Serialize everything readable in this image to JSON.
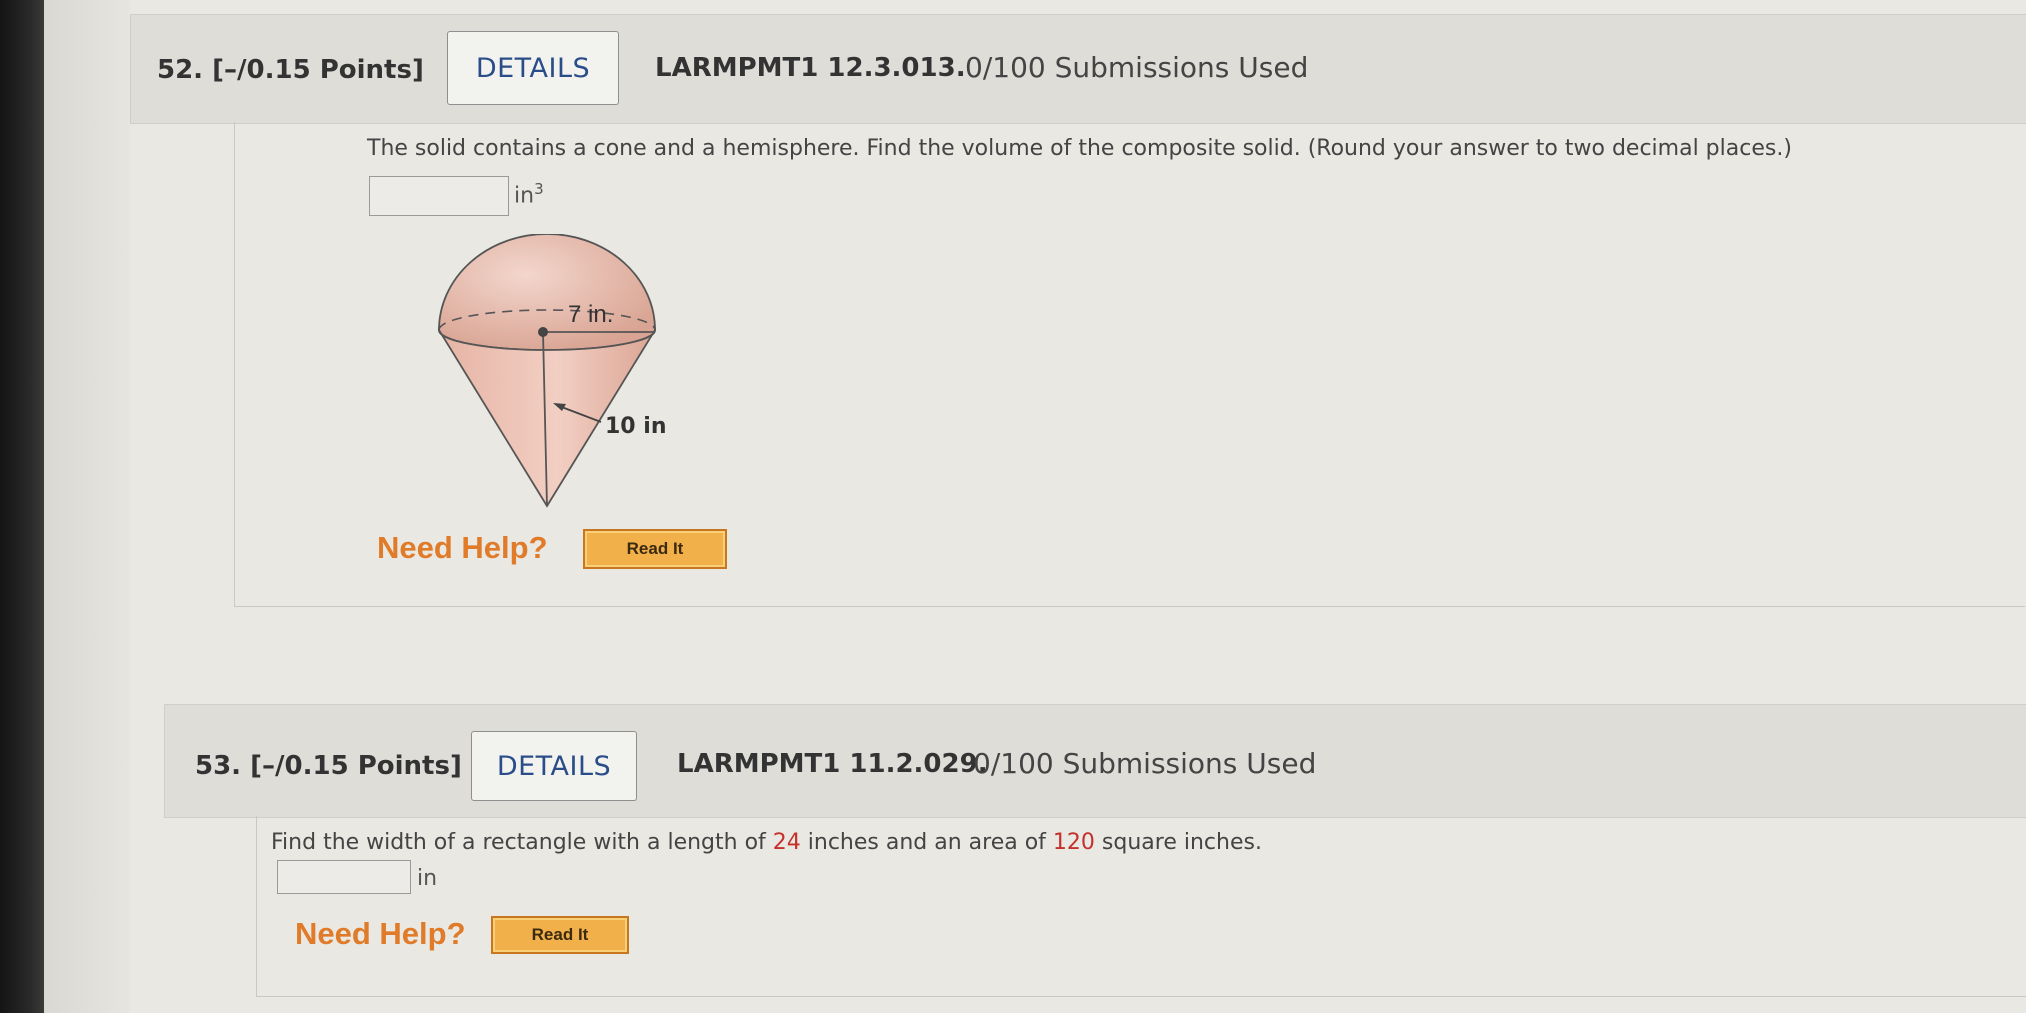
{
  "q52": {
    "number": "52.",
    "points": "[–/0.15 Points]",
    "details_label": "DETAILS",
    "code": "LARMPMT1 12.3.013.",
    "submissions": "0/100 Submissions Used",
    "prompt": "The solid contains a cone and a hemisphere. Find the volume of the composite solid. (Round your answer to two decimal places.)",
    "answer_value": "",
    "unit_base": "in",
    "unit_exp": "3",
    "figure": {
      "radius_label": "7 in.",
      "slant_label": "10 in"
    },
    "need_help": "Need Help?",
    "read_it": "Read It"
  },
  "q53": {
    "number": "53.",
    "points": "[–/0.15 Points]",
    "details_label": "DETAILS",
    "code": "LARMPMT1 11.2.029.",
    "submissions": "0/100 Submissions Used",
    "prompt_before": "Find the width of a rectangle with a length of ",
    "length": "24",
    "prompt_mid": " inches and an area of ",
    "area": "120",
    "prompt_after": " square inches.",
    "answer_value": "",
    "unit": "in",
    "need_help": "Need Help?",
    "read_it": "Read It"
  },
  "colors": {
    "highlight": "#c4302b",
    "details_text": "#2a4d8a",
    "need_help": "#e07b2a",
    "read_it_bg": "#f1b04a",
    "solid_fill": "#eec7bb"
  }
}
